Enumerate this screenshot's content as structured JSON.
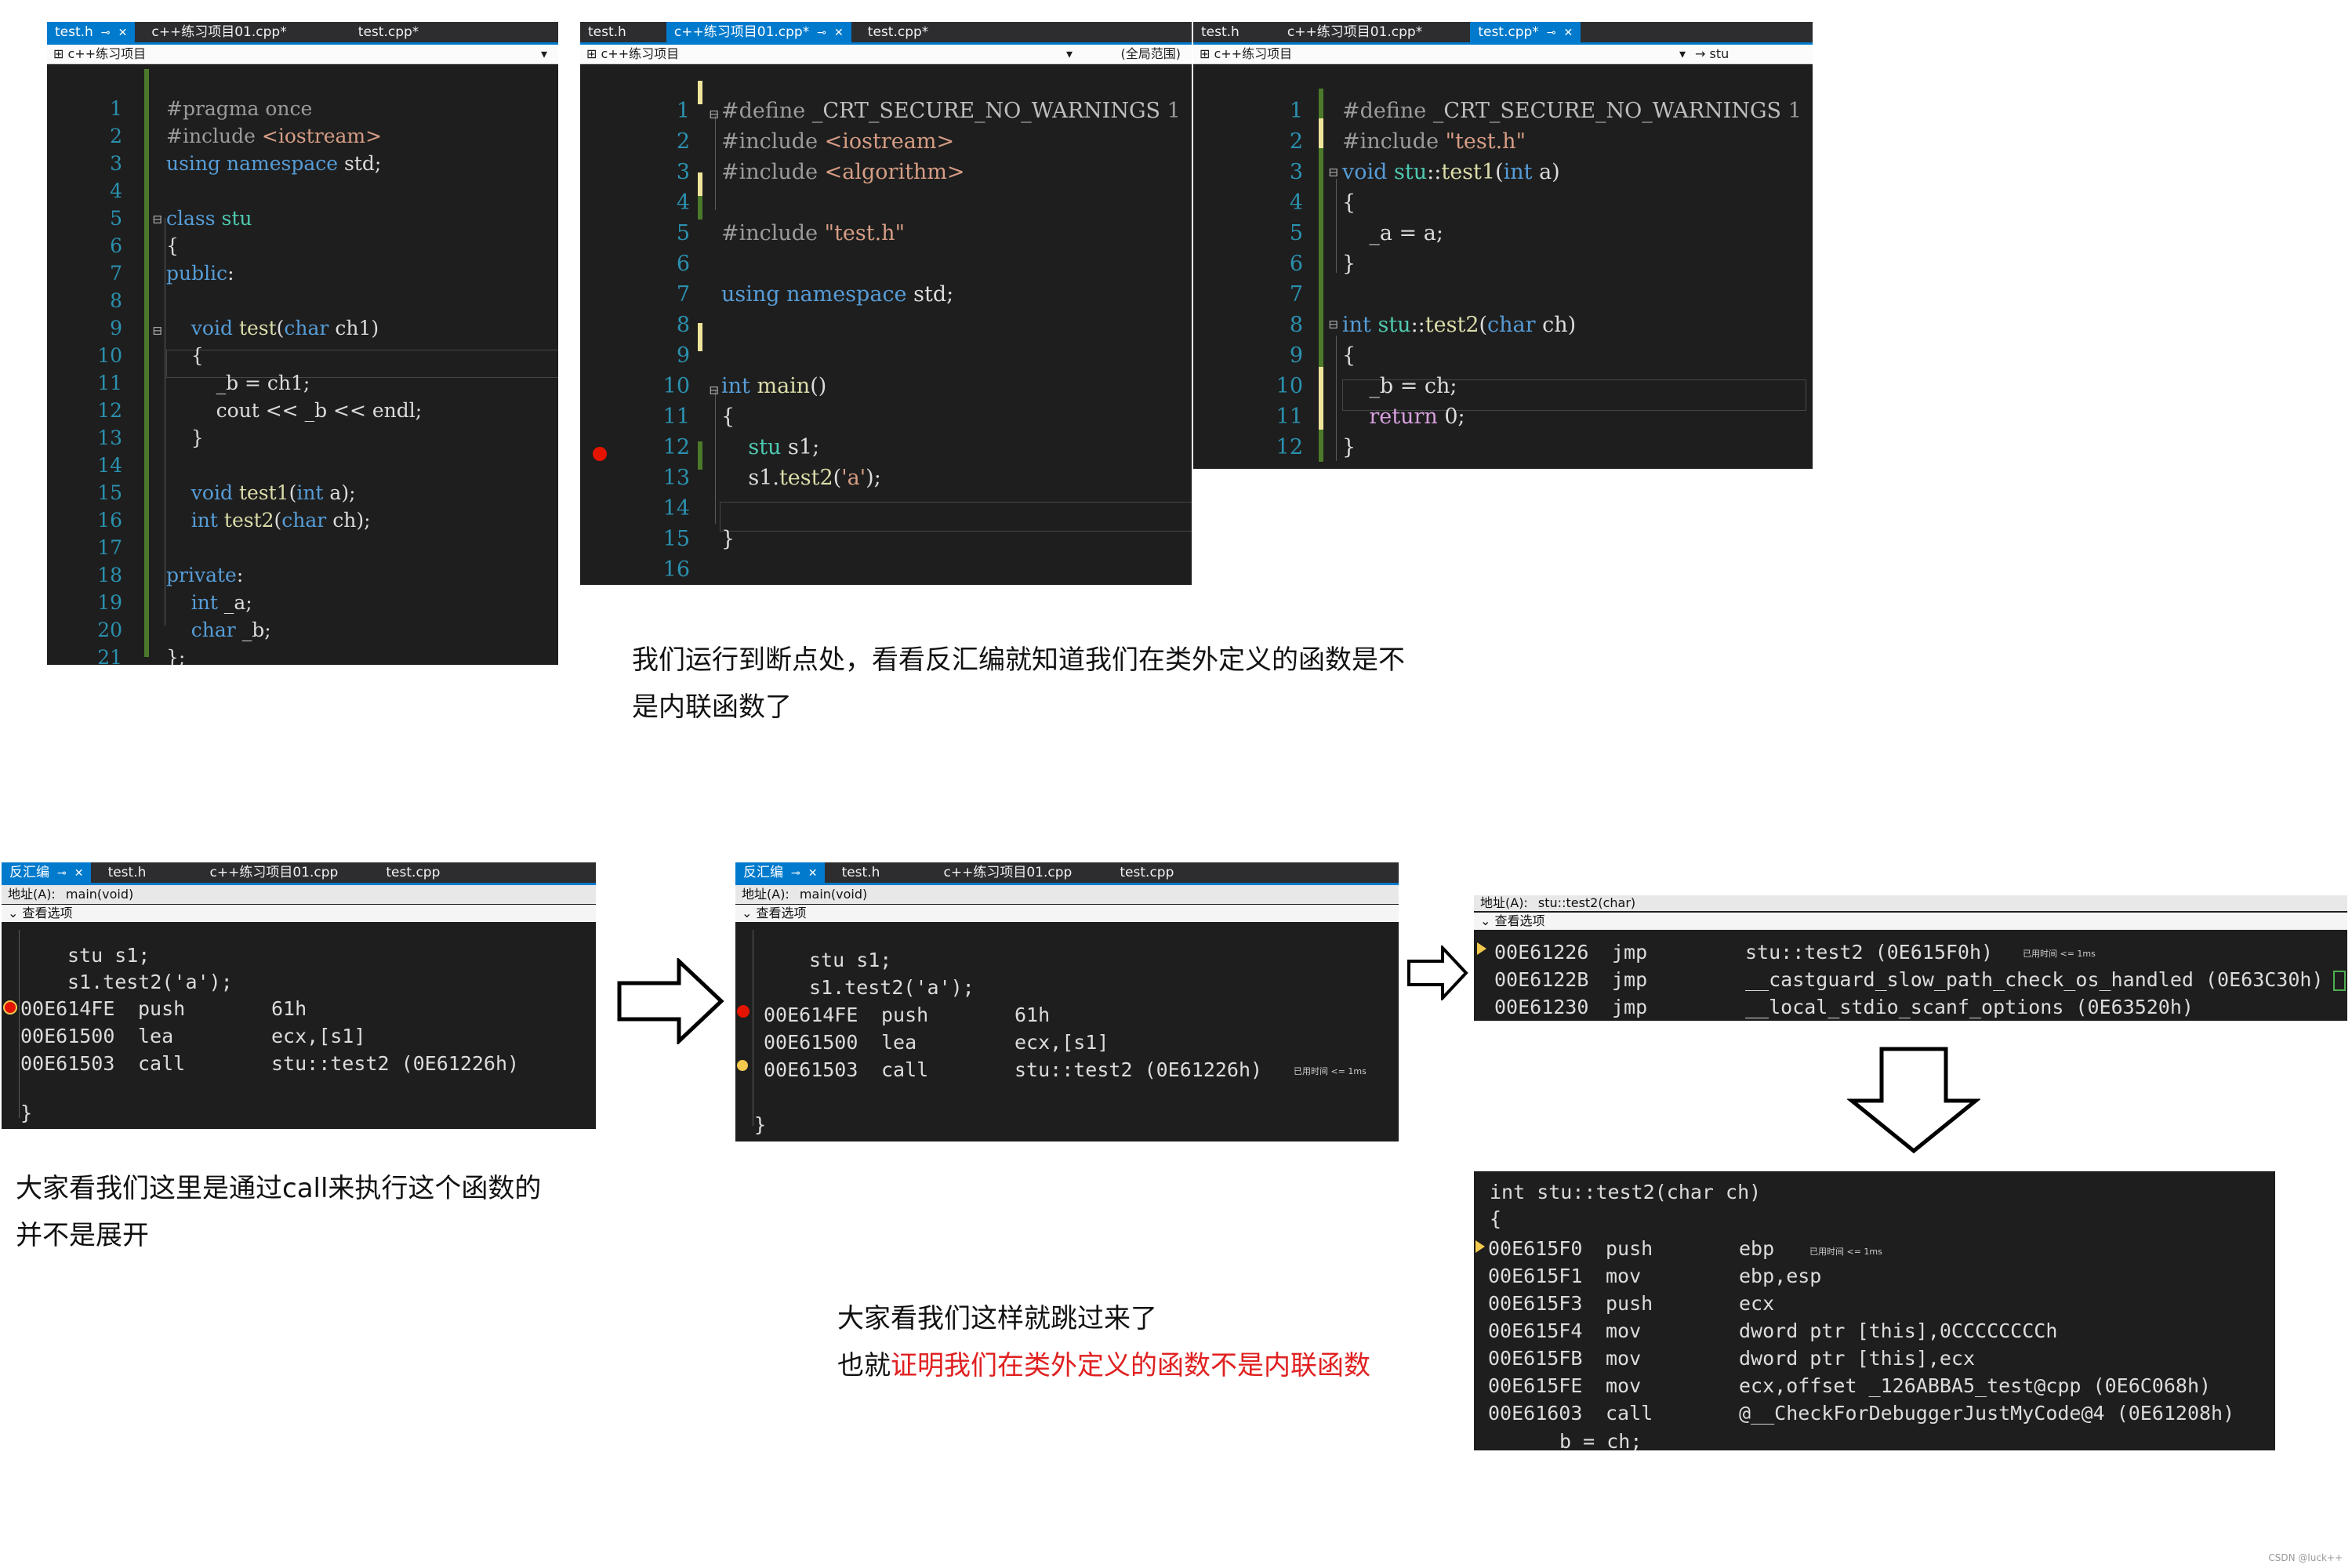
{
  "panel1": {
    "tabs": [
      "test.h",
      "c++练习项目01.cpp*",
      "test.cpp*"
    ],
    "nav": "c++练习项目",
    "line_numbers": [
      "1",
      "2",
      "3",
      "4",
      "5",
      "6",
      "7",
      "8",
      "9",
      "10",
      "11",
      "12",
      "13",
      "14",
      "15",
      "16",
      "17",
      "18",
      "19",
      "20",
      "21"
    ]
  },
  "panel2": {
    "tabs": [
      "test.h",
      "c++练习项目01.cpp*",
      "test.cpp*"
    ],
    "nav": "c++练习项目",
    "nav_right": "(全局范围)",
    "line_numbers": [
      "1",
      "2",
      "3",
      "4",
      "5",
      "6",
      "7",
      "8",
      "9",
      "10",
      "11",
      "12",
      "13",
      "14",
      "15",
      "16"
    ]
  },
  "panel3": {
    "tabs": [
      "test.h",
      "c++练习项目01.cpp*",
      "test.cpp*"
    ],
    "nav": "c++练习项目",
    "nav_right": "→ stu",
    "line_numbers": [
      "1",
      "2",
      "3",
      "4",
      "5",
      "6",
      "7",
      "8",
      "9",
      "10",
      "11",
      "12"
    ]
  },
  "caption1": {
    "line1": "我们运行到断点处，看看反汇编就知道我们在类外定义的函数是不",
    "line2": "是内联函数了"
  },
  "dis1": {
    "tabs": [
      "反汇编",
      "test.h",
      "c++练习项目01.cpp",
      "test.cpp"
    ],
    "address_label": "地址(A):",
    "address_value": "main(void)",
    "view_options": "查看选项",
    "src1": "stu s1;",
    "src2": "s1.test2('a');",
    "rows": [
      {
        "addr": "00E614FE",
        "op": "push",
        "arg": "61h"
      },
      {
        "addr": "00E61500",
        "op": "lea",
        "arg": "ecx,[s1]"
      },
      {
        "addr": "00E61503",
        "op": "call",
        "arg": "stu::test2 (0E61226h)"
      }
    ],
    "close": "}"
  },
  "caption2": {
    "line1": "大家看我们这里是通过call来执行这个函数的",
    "line2": "并不是展开"
  },
  "dis2": {
    "tabs": [
      "反汇编",
      "test.h",
      "c++练习项目01.cpp",
      "test.cpp"
    ],
    "address_label": "地址(A):",
    "address_value": "main(void)",
    "view_options": "查看选项",
    "src1": "stu s1;",
    "src2": "s1.test2('a');",
    "rows": [
      {
        "addr": "00E614FE",
        "op": "push",
        "arg": "61h"
      },
      {
        "addr": "00E61500",
        "op": "lea",
        "arg": "ecx,[s1]"
      },
      {
        "addr": "00E61503",
        "op": "call",
        "arg": "stu::test2 (0E61226h)"
      }
    ],
    "elapsed": "已用时间 <= 1ms",
    "close": "}"
  },
  "dis3": {
    "address_label": "地址(A):",
    "address_value": "stu::test2(char)",
    "view_options": "查看选项",
    "rows": [
      {
        "addr": "00E61226",
        "op": "jmp",
        "arg": "stu::test2 (0E615F0h)"
      },
      {
        "addr": "00E6122B",
        "op": "jmp",
        "arg": "__castguard_slow_path_check_os_handled (0E63C30h)"
      },
      {
        "addr": "00E61230",
        "op": "jmp",
        "arg": "__local_stdio_scanf_options (0E63520h)"
      }
    ],
    "elapsed": "已用时间 <= 1ms"
  },
  "dis4": {
    "header": "int stu::test2(char ch)",
    "brace": "{",
    "rows": [
      {
        "addr": "00E615F0",
        "op": "push",
        "arg": "ebp"
      },
      {
        "addr": "00E615F1",
        "op": "mov",
        "arg": "ebp,esp"
      },
      {
        "addr": "00E615F3",
        "op": "push",
        "arg": "ecx"
      },
      {
        "addr": "00E615F4",
        "op": "mov",
        "arg": "dword ptr [this],0CCCCCCCCh"
      },
      {
        "addr": "00E615FB",
        "op": "mov",
        "arg": "dword ptr [this],ecx"
      },
      {
        "addr": "00E615FE",
        "op": "mov",
        "arg": "ecx,offset _126ABBA5_test@cpp (0E6C068h)"
      },
      {
        "addr": "00E61603",
        "op": "call",
        "arg": "@__CheckForDebuggerJustMyCode@4 (0E61208h)"
      }
    ],
    "tail": "_b = ch;",
    "elapsed": "已用时间 <= 1ms"
  },
  "caption3": {
    "line1": "大家看我们这样就跳过来了",
    "line2_prefix": "也就",
    "line2_red": "证明我们在类外定义的函数不是内联函数"
  },
  "watermark": "CSDN @luck++",
  "colors": {
    "editor_bg": "#1e1e1e",
    "tab_active": "#007acc",
    "keyword": "#569cd6",
    "string": "#d69d85",
    "linenumber": "#2b91af",
    "breakpoint": "#e51400",
    "highlight": "#e02020"
  }
}
